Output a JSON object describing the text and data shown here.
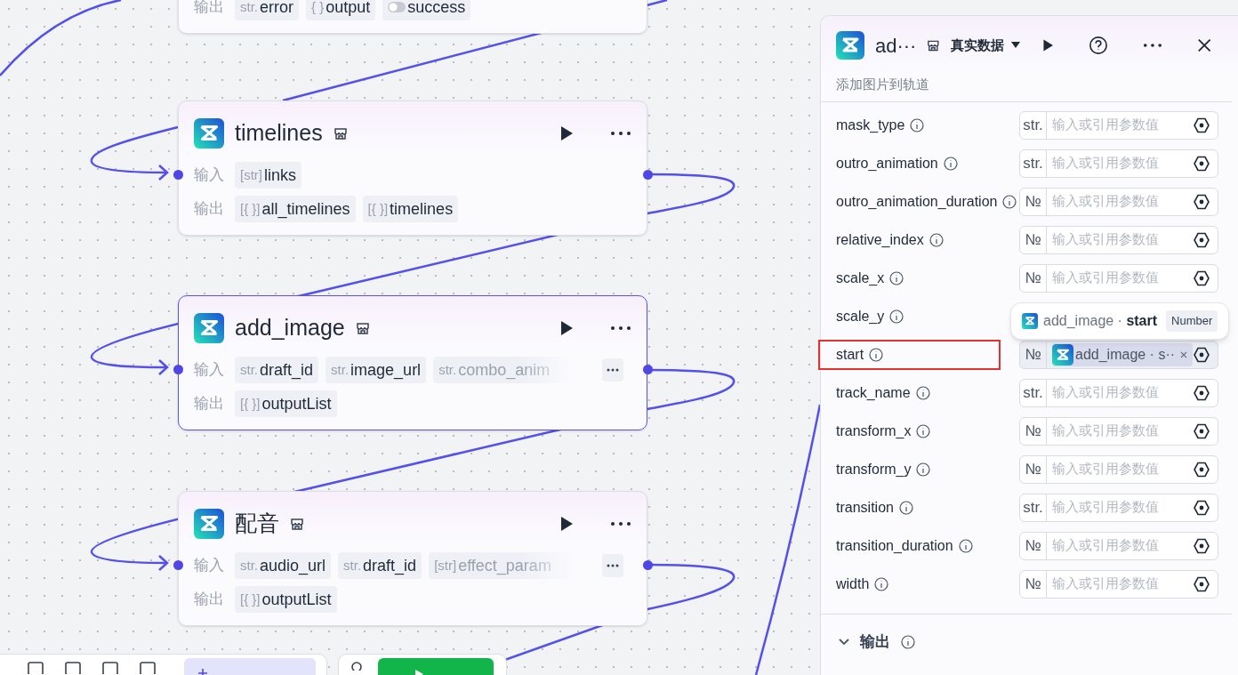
{
  "canvas": {
    "nodes": [
      {
        "selected": false,
        "outputs": [
          {
            "kind": "typed",
            "type": "str.",
            "name": "error"
          },
          {
            "kind": "typed",
            "type": "{ }",
            "name": "output"
          },
          {
            "kind": "toggle",
            "name": "success"
          }
        ],
        "output_label": "输出"
      },
      {
        "title": "timelines",
        "selected": false,
        "input_label": "输入",
        "output_label": "输出",
        "inputs": [
          {
            "kind": "typed",
            "type": "[str]",
            "name": "links"
          }
        ],
        "outputs": [
          {
            "kind": "typed",
            "type": "[{ }]",
            "name": "all_timelines"
          },
          {
            "kind": "typed",
            "type": "[{ }]",
            "name": "timelines"
          }
        ],
        "more_inputs": false
      },
      {
        "title": "add_image",
        "selected": true,
        "input_label": "输入",
        "output_label": "输出",
        "inputs": [
          {
            "kind": "typed",
            "type": "str.",
            "name": "draft_id"
          },
          {
            "kind": "typed",
            "type": "str.",
            "name": "image_url"
          },
          {
            "kind": "faded",
            "type": "str.",
            "name": "combo_anim"
          }
        ],
        "outputs": [
          {
            "kind": "typed",
            "type": "[{ }]",
            "name": "outputList"
          }
        ],
        "more_inputs": true
      },
      {
        "title": "配音",
        "selected": false,
        "input_label": "输入",
        "output_label": "输出",
        "inputs": [
          {
            "kind": "typed",
            "type": "str.",
            "name": "audio_url"
          },
          {
            "kind": "typed",
            "type": "str.",
            "name": "draft_id"
          },
          {
            "kind": "faded",
            "type": "[str]",
            "name": "effect_param"
          }
        ],
        "outputs": [
          {
            "kind": "typed",
            "type": "[{ }]",
            "name": "outputList"
          }
        ],
        "more_inputs": true
      }
    ]
  },
  "panel": {
    "title": "ad···",
    "data_mode": "真实数据",
    "description": "添加图片到轨道",
    "params": [
      {
        "name": "mask_type",
        "highlighted": false,
        "type": "str.",
        "placeholder": "输入或引用参数值"
      },
      {
        "name": "outro_animation",
        "highlighted": false,
        "type": "str.",
        "placeholder": "输入或引用参数值"
      },
      {
        "name": "outro_animation_duration",
        "highlighted": false,
        "type": "№",
        "placeholder": "输入或引用参数值"
      },
      {
        "name": "relative_index",
        "highlighted": false,
        "type": "№",
        "placeholder": "输入或引用参数值"
      },
      {
        "name": "scale_x",
        "highlighted": false,
        "type": "№",
        "placeholder": "输入或引用参数值"
      },
      {
        "name": "scale_y",
        "highlighted": false
      },
      {
        "name": "start",
        "highlighted": true,
        "type": "№",
        "reference": "add_image · s··"
      },
      {
        "name": "track_name",
        "highlighted": false,
        "type": "str.",
        "placeholder": "输入或引用参数值"
      },
      {
        "name": "transform_x",
        "highlighted": false,
        "type": "№",
        "placeholder": "输入或引用参数值"
      },
      {
        "name": "transform_y",
        "highlighted": false,
        "type": "№",
        "placeholder": "输入或引用参数值"
      },
      {
        "name": "transition",
        "highlighted": false,
        "type": "str.",
        "placeholder": "输入或引用参数值"
      },
      {
        "name": "transition_duration",
        "highlighted": false,
        "type": "№",
        "placeholder": "输入或引用参数值"
      },
      {
        "name": "width",
        "highlighted": false,
        "type": "№",
        "placeholder": "输入或引用参数值"
      }
    ],
    "tooltip": {
      "text": "add_image · **start**",
      "type": "Number"
    },
    "output_section": {
      "label": "输出",
      "expanded": true
    }
  }
}
